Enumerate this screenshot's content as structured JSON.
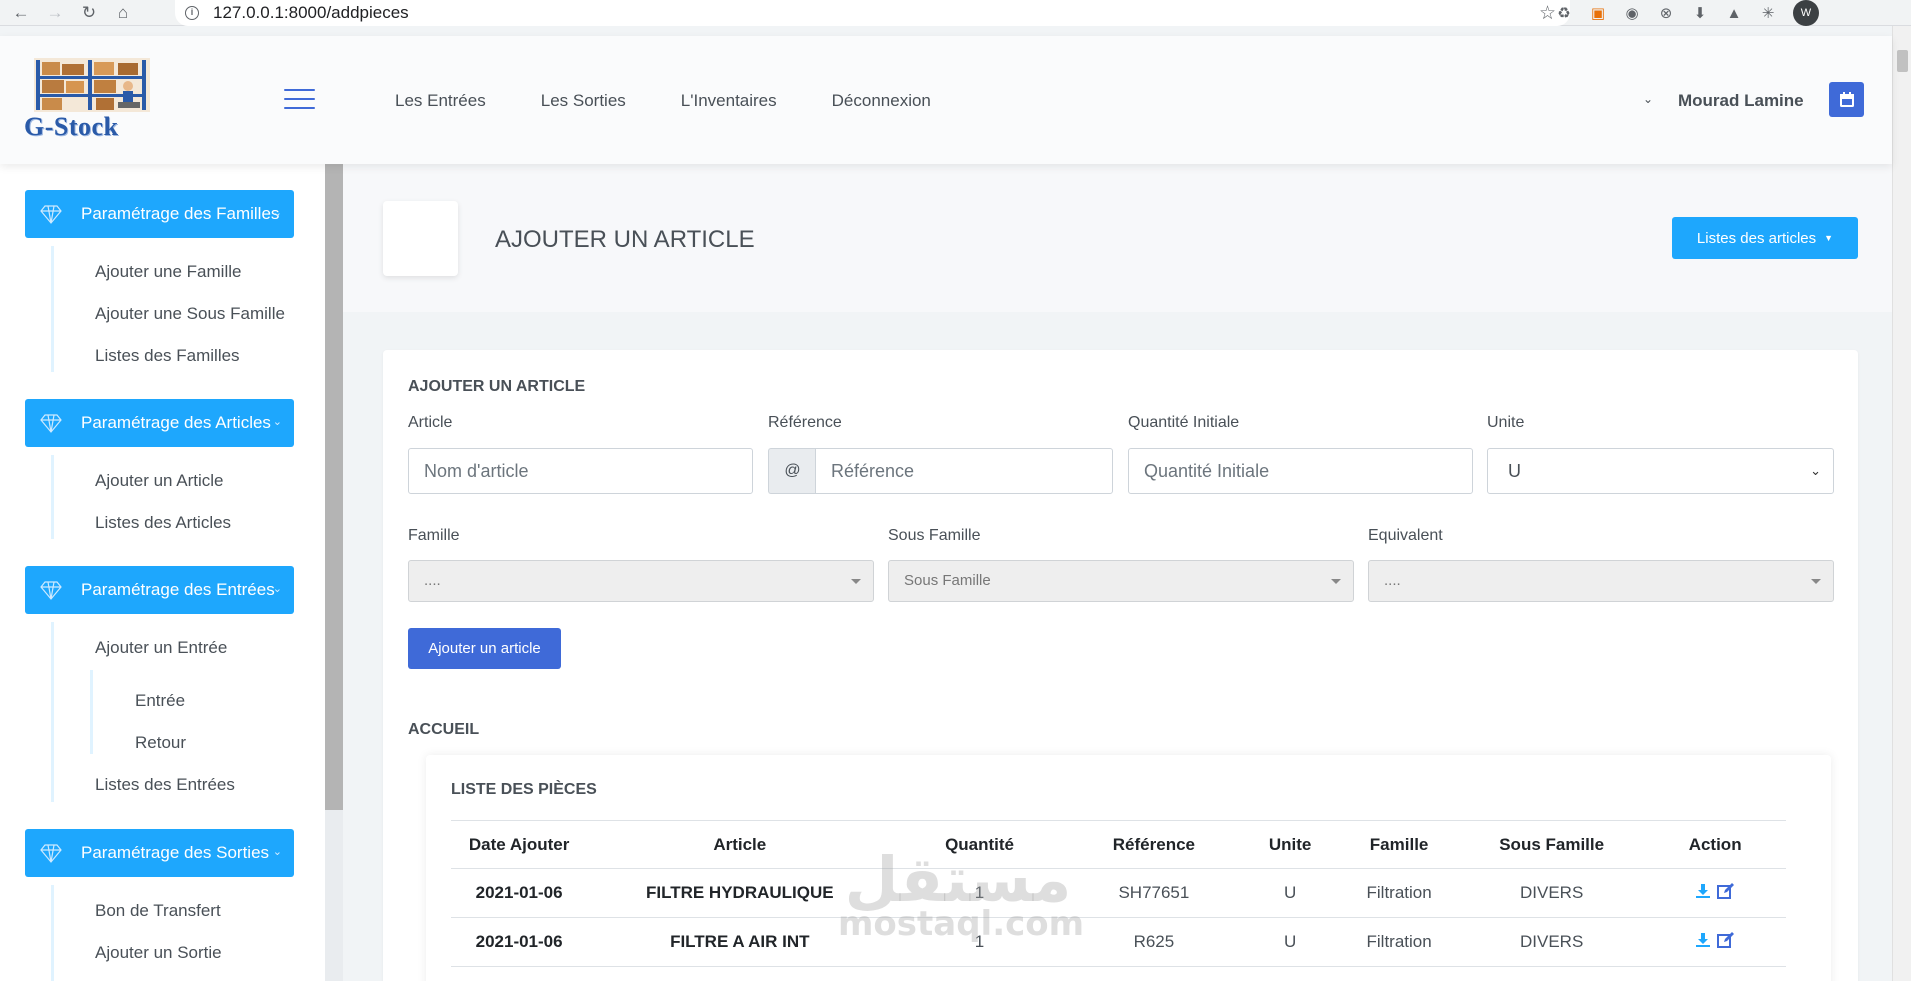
{
  "browser": {
    "url": "127.0.0.1:8000/addpieces",
    "profile_initial": "W"
  },
  "header": {
    "brand": "G-Stock",
    "nav": [
      "Les Entrées",
      "Les Sorties",
      "L'Inventaires",
      "Déconnexion"
    ],
    "user_name": "Mourad Lamine",
    "accent": "#3f6ad8"
  },
  "sidebar": {
    "accent": "#1ea7fd",
    "groups": [
      {
        "title": "Paramétrage des Familles",
        "items": [
          "Ajouter une Famille",
          "Ajouter une Sous Famille",
          "Listes des Familles"
        ]
      },
      {
        "title": "Paramétrage des Articles",
        "items": [
          "Ajouter un Article",
          "Listes des Articles"
        ]
      },
      {
        "title": "Paramétrage des Entrées",
        "items": [
          "Ajouter un Entrée",
          "Listes des Entrées"
        ],
        "subitems": [
          "Entrée",
          "Retour"
        ]
      },
      {
        "title": "Paramétrage des Sorties",
        "items": [
          "Bon de Transfert",
          "Ajouter un Sortie"
        ]
      }
    ]
  },
  "page": {
    "title": "AJOUTER UN ARTICLE",
    "list_button": "Listes des articles"
  },
  "form": {
    "title": "AJOUTER UN ARTICLE",
    "article_label": "Article",
    "article_placeholder": "Nom d'article",
    "reference_label": "Référence",
    "reference_addon": "@",
    "reference_placeholder": "Référence",
    "quantite_label": "Quantité Initiale",
    "quantite_placeholder": "Quantité Initiale",
    "unite_label": "Unite",
    "unite_value": "U",
    "famille_label": "Famille",
    "famille_value": "....",
    "sous_famille_label": "Sous Famille",
    "sous_famille_value": "Sous Famille",
    "equivalent_label": "Equivalent",
    "equivalent_value": "....",
    "submit_label": "Ajouter un article"
  },
  "section_label": "ACCUEIL",
  "table": {
    "title": "LISTE DES PIÈCES",
    "columns": [
      "Date Ajouter",
      "Article",
      "Quantité",
      "Référence",
      "Unite",
      "Famille",
      "Sous Famille",
      "Action"
    ],
    "rows": [
      [
        "2021-01-06",
        "FILTRE HYDRAULIQUE",
        "1",
        "SH77651",
        "U",
        "Filtration",
        "DIVERS"
      ],
      [
        "2021-01-06",
        "FILTRE A AIR INT",
        "1",
        "R625",
        "U",
        "Filtration",
        "DIVERS"
      ]
    ]
  },
  "watermark": {
    "arabic": "مستقل",
    "latin": "mostaql.com"
  }
}
